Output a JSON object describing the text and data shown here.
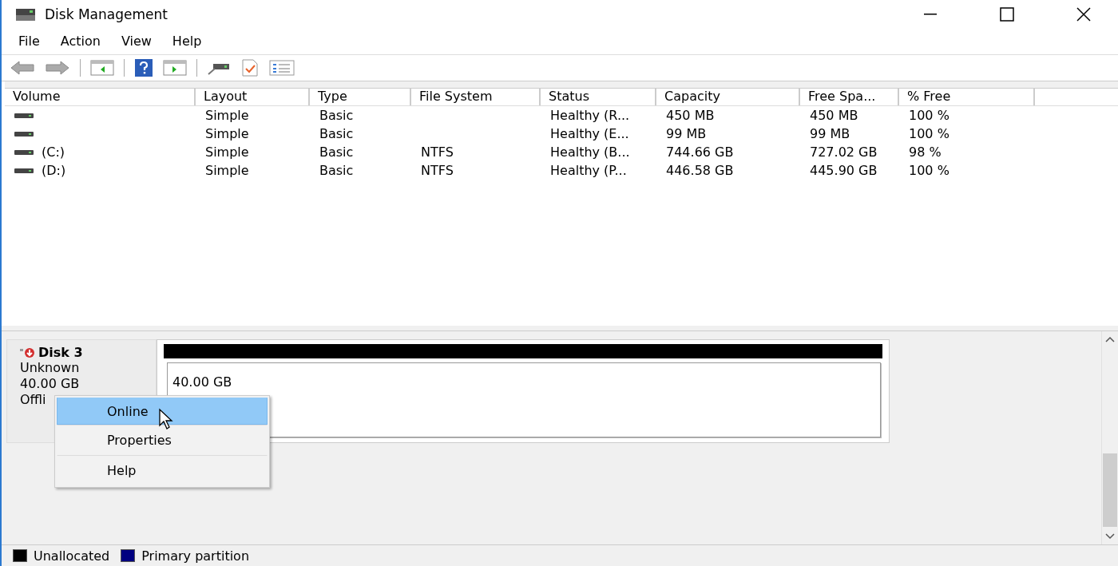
{
  "window": {
    "title": "Disk Management"
  },
  "menu_bar": [
    "File",
    "Action",
    "View",
    "Help"
  ],
  "toolbar": [
    {
      "kind": "back"
    },
    {
      "kind": "forward"
    },
    {
      "kind": "sep"
    },
    {
      "kind": "panel-left"
    },
    {
      "kind": "sep"
    },
    {
      "kind": "help"
    },
    {
      "kind": "panel-right"
    },
    {
      "kind": "sep"
    },
    {
      "kind": "drive"
    },
    {
      "kind": "check-doc"
    },
    {
      "kind": "list"
    }
  ],
  "table": {
    "columns": [
      "Volume",
      "Layout",
      "Type",
      "File System",
      "Status",
      "Capacity",
      "Free Spa...",
      "% Free"
    ],
    "rows": [
      {
        "volume": "",
        "layout": "Simple",
        "type": "Basic",
        "file_system": "",
        "status": "Healthy (R...",
        "capacity": "450 MB",
        "free_space": "450 MB",
        "percent_free": "100 %"
      },
      {
        "volume": "",
        "layout": "Simple",
        "type": "Basic",
        "file_system": "",
        "status": "Healthy (E...",
        "capacity": "99 MB",
        "free_space": "99 MB",
        "percent_free": "100 %"
      },
      {
        "volume": "(C:)",
        "layout": "Simple",
        "type": "Basic",
        "file_system": "NTFS",
        "status": "Healthy (B...",
        "capacity": "744.66 GB",
        "free_space": "727.02 GB",
        "percent_free": "98 %"
      },
      {
        "volume": "(D:)",
        "layout": "Simple",
        "type": "Basic",
        "file_system": "NTFS",
        "status": "Healthy (P...",
        "capacity": "446.58 GB",
        "free_space": "445.90 GB",
        "percent_free": "100 %"
      }
    ]
  },
  "disk": {
    "name": "Disk 3",
    "lines": [
      "Unknown",
      "40.00 GB",
      "Offli"
    ],
    "partition": {
      "size": "40.00 GB",
      "color": "#000000"
    }
  },
  "context_menu": [
    {
      "label": "Online",
      "selected": true
    },
    {
      "label": "Properties",
      "selected": false
    },
    {
      "label": "Help",
      "selected": false
    }
  ],
  "legend": [
    {
      "label": "Unallocated",
      "color": "#000000"
    },
    {
      "label": "Primary partition",
      "color": "#000080"
    }
  ]
}
